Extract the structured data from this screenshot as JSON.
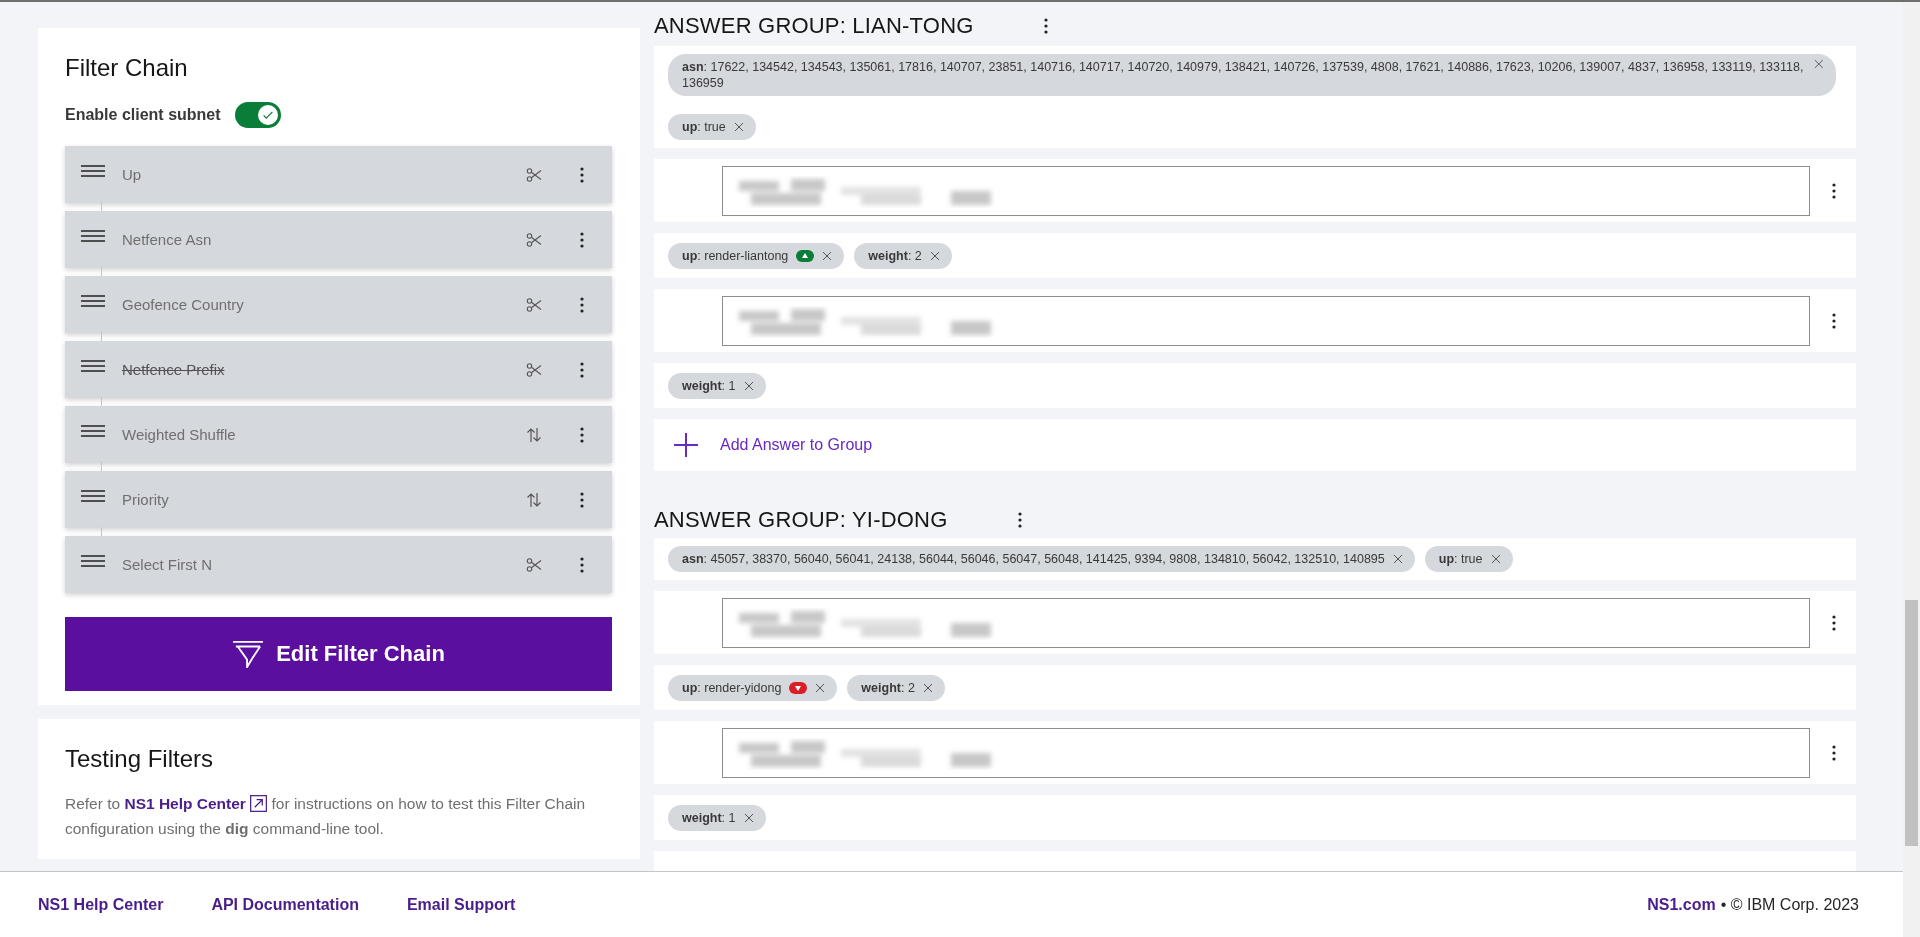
{
  "filter_chain": {
    "title": "Filter Chain",
    "toggle": {
      "label": "Enable client subnet",
      "on": true
    },
    "filters": [
      {
        "label": "Up",
        "kind": "scissors",
        "disabled": false
      },
      {
        "label": "Netfence Asn",
        "kind": "scissors",
        "disabled": false
      },
      {
        "label": "Geofence Country",
        "kind": "scissors",
        "disabled": false
      },
      {
        "label": "Netfence Prefix",
        "kind": "scissors",
        "disabled": true
      },
      {
        "label": "Weighted Shuffle",
        "kind": "sort",
        "disabled": false
      },
      {
        "label": "Priority",
        "kind": "sort",
        "disabled": false
      },
      {
        "label": "Select First N",
        "kind": "scissors",
        "disabled": false
      }
    ],
    "button": "Edit Filter Chain"
  },
  "testing": {
    "title": "Testing Filters",
    "text_before": "Refer to ",
    "link": "NS1 Help Center",
    "text_after": " for instructions on how to test this Filter Chain configuration using the **dig** command-line tool."
  },
  "answer_groups": [
    {
      "title": "ANSWER GROUP: LIAN-TONG",
      "meta_rows": [
        [
          {
            "text": "**asn**: 17622, 134542, 134543, 135061, 17816, 140707, 23851, 140716, 140717, 140720, 140979, 138421, 140726, 137539, 4808, 17621, 140886, 17623, 10206, 139007, 4837, 136958, 133119, 133118, 136959"
          }
        ],
        [
          {
            "text": "**up**: true"
          }
        ]
      ],
      "answers": [
        {
          "meta": [
            {
              "text": "**up**: render-liantong",
              "healthy": true
            },
            {
              "text": "**weight**: 2"
            }
          ]
        },
        {
          "meta": [
            {
              "text": "**weight**: 1"
            }
          ]
        }
      ],
      "add_label": "Add Answer to Group"
    },
    {
      "title": "ANSWER GROUP: YI-DONG",
      "meta_rows": [
        [
          {
            "text": "**asn**: 45057, 38370, 56040, 56041, 24138, 56044, 56046, 56047, 56048, 141425, 9394, 9808, 134810, 56042, 132510, 140895"
          },
          {
            "text": "**up**: true"
          }
        ]
      ],
      "answers": [
        {
          "meta": [
            {
              "text": "**up**: render-yidong",
              "healthy": false
            },
            {
              "text": "**weight**: 2"
            }
          ]
        },
        {
          "meta": [
            {
              "text": "**weight**: 1"
            }
          ]
        }
      ]
    }
  ],
  "footer": {
    "links": [
      "NS1 Help Center",
      "API Documentation",
      "Email Support"
    ],
    "site": "NS1.com",
    "copyright": "• © IBM Corp. 2023"
  }
}
